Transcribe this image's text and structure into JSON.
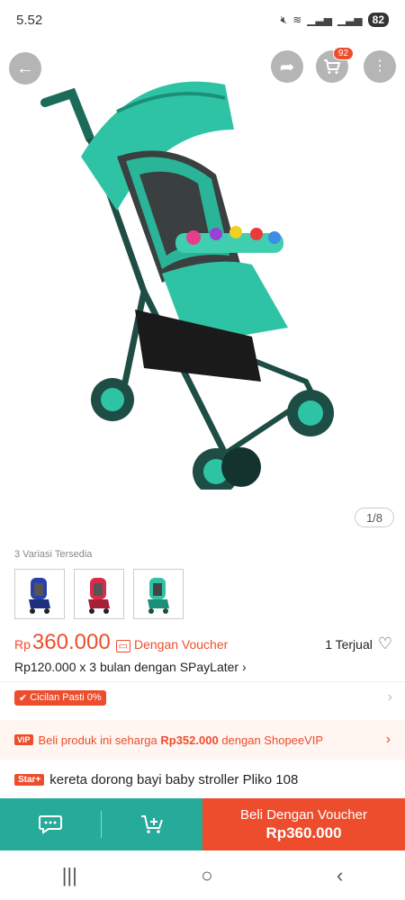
{
  "status_bar": {
    "time": "5.52",
    "battery": "82"
  },
  "header": {
    "cart_count": "92"
  },
  "gallery": {
    "indicator": "1/8"
  },
  "variants": {
    "label": "3 Variasi Tersedia",
    "count": 3
  },
  "price": {
    "currency": "Rp",
    "value": "360.000",
    "voucher_label": "Dengan Voucher",
    "sold": "1 Terjual",
    "installment": "Rp120.000 x 3 bulan dengan SPayLater ›"
  },
  "cicilan": {
    "badge": "Cicilan Pasti 0%"
  },
  "vip": {
    "badge": "VIP",
    "text_prefix": "Beli produk ini seharga ",
    "price": "Rp352.000",
    "text_suffix": " dengan ShopeeVIP"
  },
  "product": {
    "star_badge": "Star+",
    "title": "kereta dorong bayi baby stroller  Pliko 108"
  },
  "action_bar": {
    "buy_label": "Beli Dengan Voucher",
    "buy_price": "Rp360.000"
  },
  "colors": {
    "accent": "#ee4d2d",
    "chat_green": "#26aa99"
  }
}
